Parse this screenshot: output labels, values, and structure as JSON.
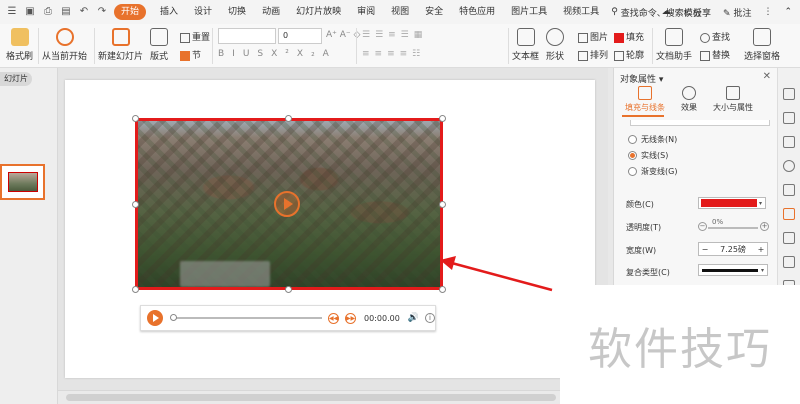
{
  "menubar": {
    "tabs": [
      "开始",
      "插入",
      "设计",
      "切换",
      "动画",
      "幻灯片放映",
      "审阅",
      "视图",
      "安全",
      "特色应用",
      "图片工具",
      "视频工具"
    ],
    "search": "查找命令、搜索模板",
    "share": "分享",
    "annotate": "批注"
  },
  "ribbon": {
    "format_painter": "格式刷",
    "from_current": "从当前开始",
    "new_slide": "新建幻灯片",
    "layout": "版式",
    "reset": "重置",
    "section": "节",
    "font_size": "0",
    "textbox": "文本框",
    "shape": "形状",
    "picture": "图片",
    "fill": "填充",
    "outline": "轮廓",
    "arrange": "排列",
    "doc_assistant": "文档助手",
    "find": "查找",
    "replace": "替换",
    "select_pane": "选择窗格"
  },
  "left_panel": {
    "tab": "幻灯片",
    "slide_number": "1"
  },
  "video": {
    "time": "00:00.00"
  },
  "property_panel": {
    "title": "对象属性",
    "tabs": [
      "填充与线条",
      "效果",
      "大小与属性"
    ],
    "line_options": [
      "无线条(N)",
      "实线(S)",
      "渐变线(G)"
    ],
    "selected_line_option": "实线(S)",
    "color_label": "颜色(C)",
    "line_color": "#e31b1b",
    "transparency_label": "透明度(T)",
    "transparency_value": "0%",
    "width_label": "宽度(W)",
    "width_value": "7.25磅",
    "compound_label": "复合类型(C)"
  },
  "watermark": "软件技巧",
  "colors": {
    "accent": "#e8722c",
    "selection_border": "#e31b1b"
  }
}
